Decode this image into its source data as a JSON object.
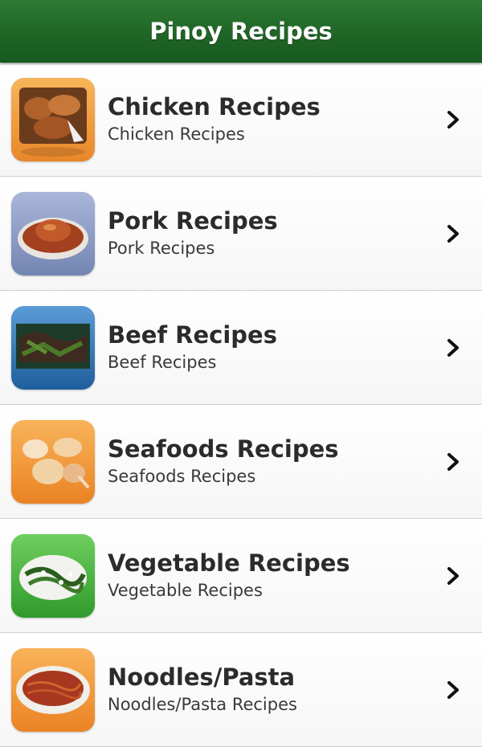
{
  "app": {
    "title": "Pinoy Recipes"
  },
  "categories": [
    {
      "title": "Chicken Recipes",
      "subtitle": "Chicken Recipes",
      "icon": "chicken-icon",
      "tile_color": "#f4a03a"
    },
    {
      "title": "Pork Recipes",
      "subtitle": "Pork Recipes",
      "icon": "pork-icon",
      "tile_color": "#8fa0c8"
    },
    {
      "title": "Beef Recipes",
      "subtitle": "Beef Recipes",
      "icon": "beef-icon",
      "tile_color": "#3a7fc2"
    },
    {
      "title": "Seafoods Recipes",
      "subtitle": "Seafoods Recipes",
      "icon": "seafood-icon",
      "tile_color": "#f39a35"
    },
    {
      "title": "Vegetable Recipes",
      "subtitle": "Vegetable Recipes",
      "icon": "vegetable-icon",
      "tile_color": "#4fb544"
    },
    {
      "title": "Noodles/Pasta",
      "subtitle": "Noodles/Pasta Recipes",
      "icon": "noodles-icon",
      "tile_color": "#f39a35"
    }
  ],
  "colors": {
    "header": "#1f6526",
    "header_text": "#ffffff",
    "title_text": "#2b2b2b"
  }
}
